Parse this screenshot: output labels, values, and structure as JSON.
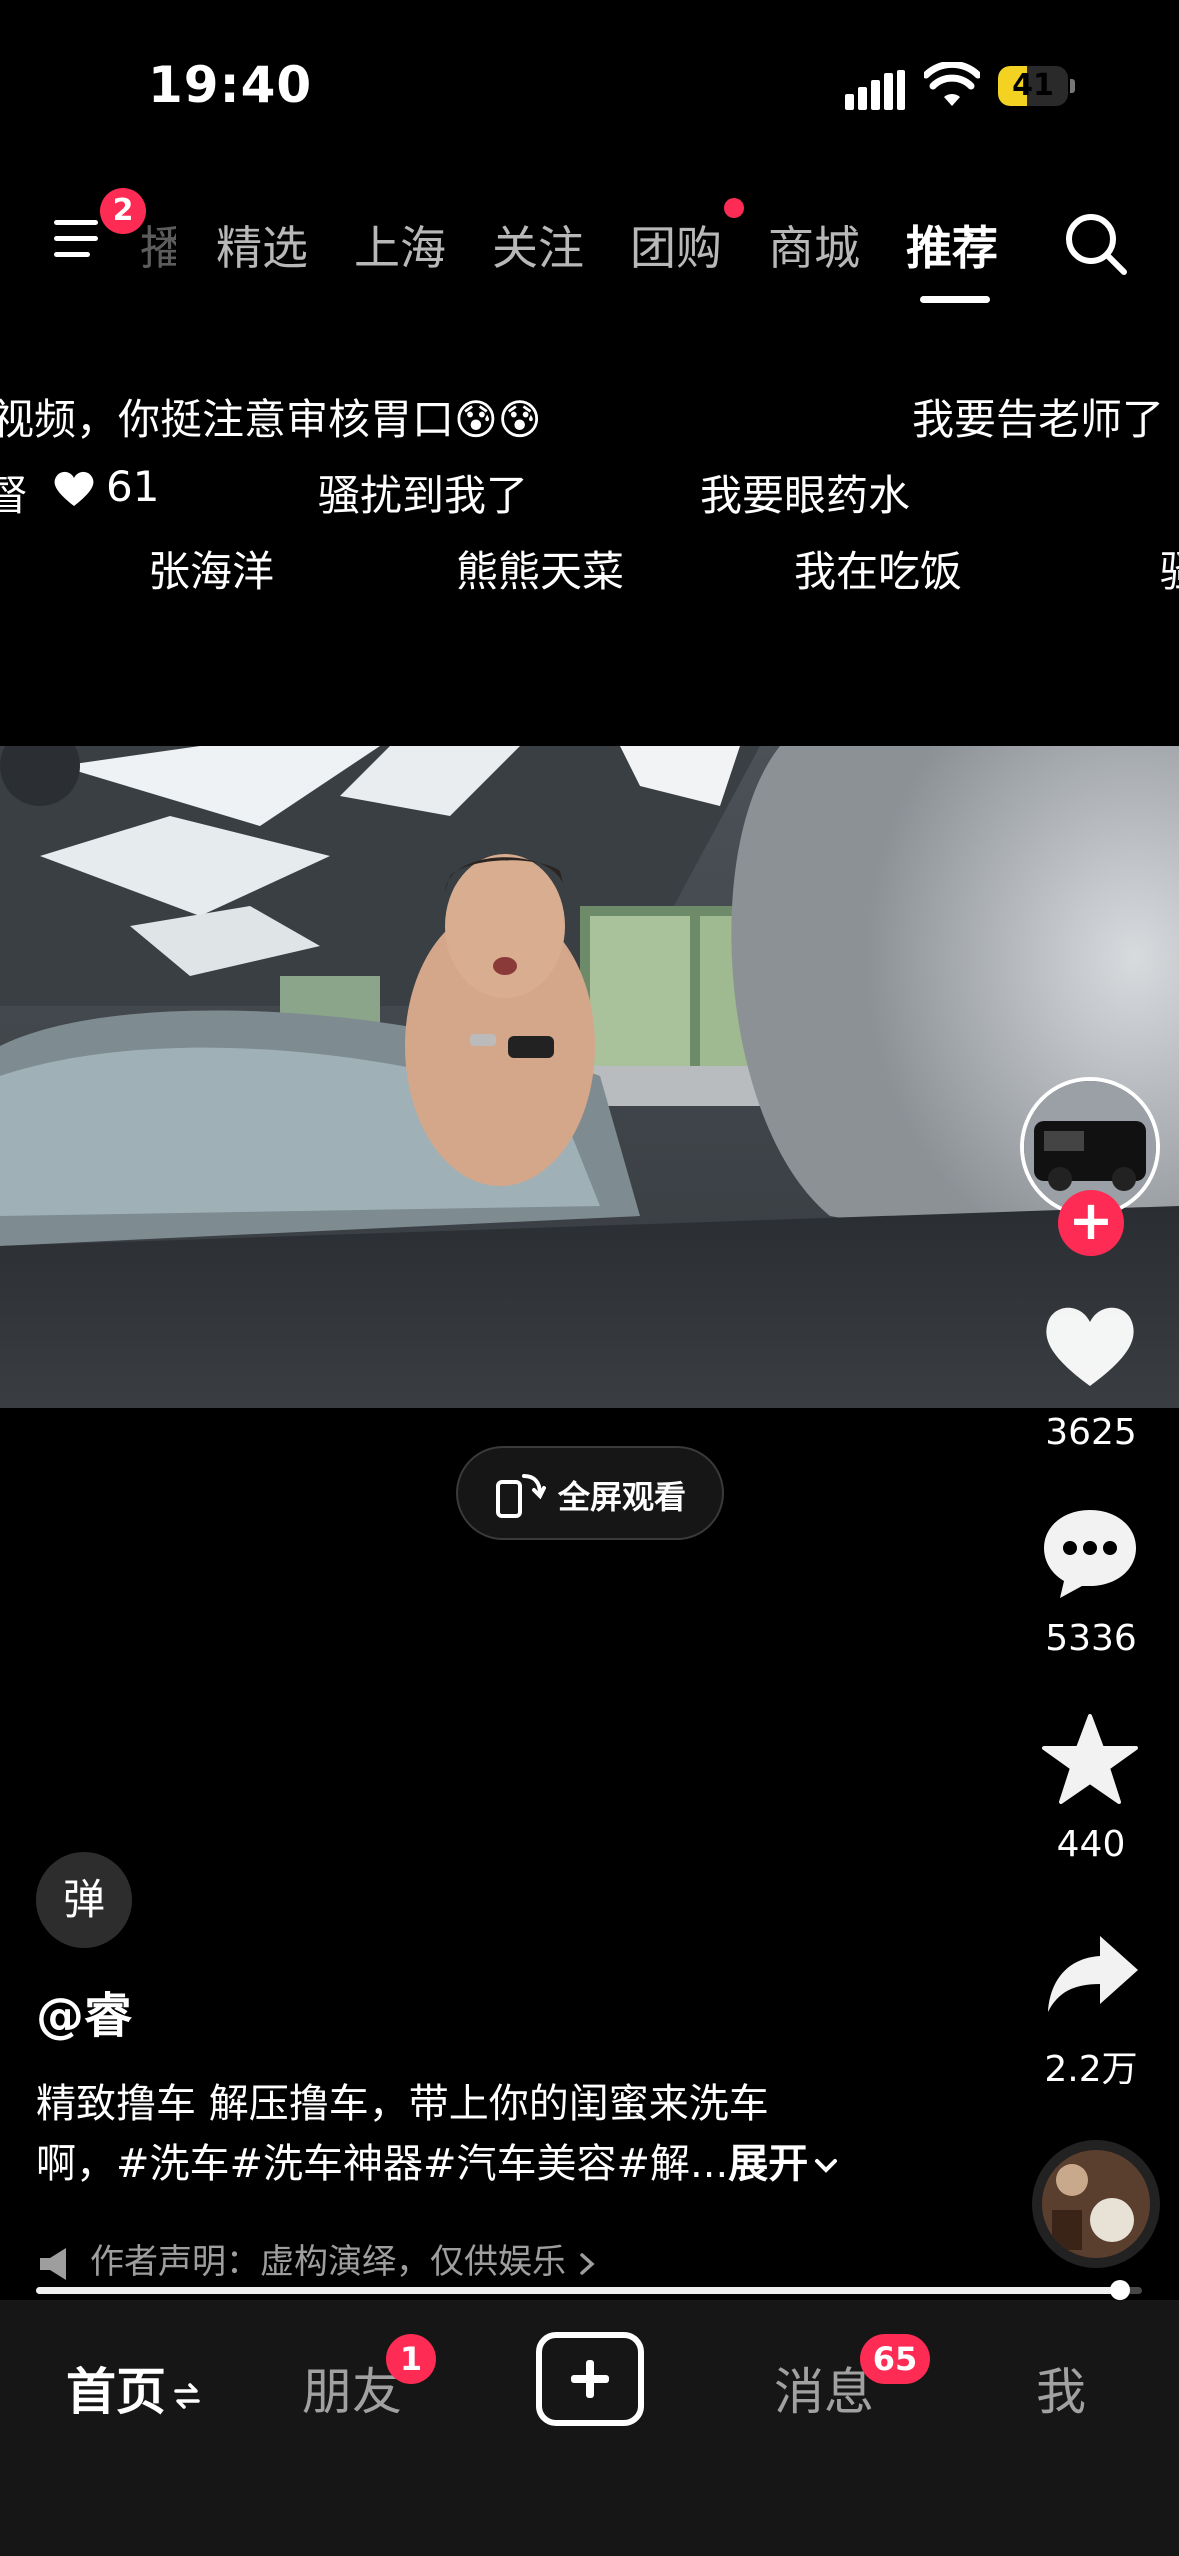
{
  "status_bar": {
    "time": "19:40",
    "battery": "41",
    "battery_fraction": 0.41
  },
  "top_nav": {
    "menu_badge": "2",
    "tabs": [
      {
        "label": "播"
      },
      {
        "label": "精选"
      },
      {
        "label": "上海"
      },
      {
        "label": "关注"
      },
      {
        "label": "团购"
      },
      {
        "label": "商城"
      },
      {
        "label": "推荐"
      }
    ]
  },
  "danmaku": {
    "row1": [
      "视频，你挺注意审核胃口😰😰",
      "我要告老师了"
    ],
    "row2": [
      "督",
      "61",
      "骚扰到我了",
      "我要眼药水"
    ],
    "row3": [
      "张海洋",
      "熊熊天菜",
      "我在吃饭",
      "骚"
    ]
  },
  "fullscreen_label": "全屏观看",
  "rail": {
    "likes": "3625",
    "comments": "5336",
    "favorites": "440",
    "shares": "2.2万"
  },
  "post": {
    "danmu_toggle": "弹",
    "author": "@睿",
    "caption_line1": "精致撸车 解压撸车，带上你的闺蜜来洗车",
    "caption_line2": "啊，#洗车#洗车神器#汽车美容#解...",
    "expand_label": "展开",
    "statement": "作者声明：虚构演绎，仅供娱乐",
    "progress_fraction": 0.98
  },
  "bottom_nav": {
    "home": "首页",
    "friends": "朋友",
    "friends_badge": "1",
    "messages": "消息",
    "messages_badge": "65",
    "me": "我"
  },
  "colors": {
    "accent": "#fe2c55",
    "battery": "#f4d221",
    "background": "#000000"
  }
}
